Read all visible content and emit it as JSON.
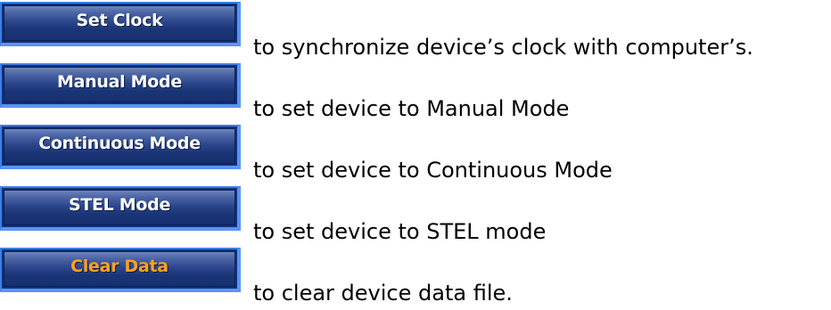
{
  "items": [
    {
      "button_label": "Set Clock",
      "description": "to synchronize device’s clock with computer’s."
    },
    {
      "button_label": "Manual Mode",
      "description": "to set device to Manual Mode"
    },
    {
      "button_label": "Continuous Mode",
      "description": "to set device to Continuous Mode"
    },
    {
      "button_label": "STEL Mode",
      "description": "to set device to STEL mode"
    },
    {
      "button_label": "Clear Data",
      "description": "to clear device data file."
    }
  ],
  "colors": {
    "button_face": "#2c478c",
    "button_border": "#3d7fe8",
    "label_default": "#ffffff",
    "label_clear_data": "#ffa21f"
  }
}
